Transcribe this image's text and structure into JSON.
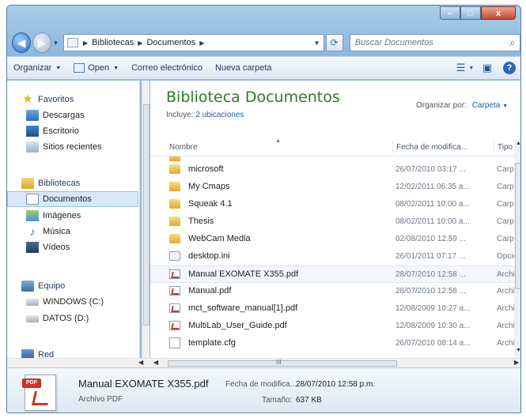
{
  "colors": {
    "library_title": "#2c7d27",
    "link": "#1a5fb4",
    "window_frame": "#8fb8de",
    "close_button": "#c74a2e"
  },
  "window": {
    "caption_buttons": [
      "minimize-icon",
      "maximize-icon",
      "close-icon"
    ],
    "close_glyph": "x"
  },
  "address": {
    "back_glyph": "◀",
    "forward_glyph": "▶",
    "crumbs": [
      "Bibliotecas",
      "Documentos"
    ],
    "search_placeholder": "Buscar Documentos"
  },
  "toolbar": {
    "organize": "Organizar",
    "open": "Open",
    "email": "Correo electrónico",
    "new_folder": "Nueva carpeta"
  },
  "nav": {
    "favorites": "Favoritos",
    "downloads": "Descargas",
    "desktop": "Escritorio",
    "recent": "Sitios recientes",
    "libraries": "Bibliotecas",
    "documents": "Documentos",
    "images": "Imágenes",
    "music": "Música",
    "videos": "Vídeos",
    "computer": "Equipo",
    "drive_c": "WINDOWS (C:)",
    "drive_d": "DATOS (D:)",
    "network": "Red"
  },
  "library": {
    "title": "Biblioteca Documentos",
    "includes_label": "Incluye:",
    "includes_link": "2 ubicaciones",
    "arrange_label": "Organizar por:",
    "arrange_value": "Carpeta"
  },
  "columns": {
    "name": "Nombre",
    "date": "Fecha de modifica...",
    "type": "Tipo"
  },
  "files": [
    {
      "name": "microsoft",
      "date": "26/07/2010 03:17 ...",
      "type": "Carpe",
      "icon": "folder-icon"
    },
    {
      "name": "My Cmaps",
      "date": "12/02/2011 06:35 a...",
      "type": "Carpe",
      "icon": "folder-icon"
    },
    {
      "name": "Squeak 4.1",
      "date": "08/02/2011 10:00 a...",
      "type": "Carpe",
      "icon": "folder-icon"
    },
    {
      "name": "Thesis",
      "date": "08/02/2011 10:00 a...",
      "type": "Carpe",
      "icon": "folder-icon"
    },
    {
      "name": "WebCam Media",
      "date": "02/08/2010 12:59 ...",
      "type": "Carpe",
      "icon": "folder-icon"
    },
    {
      "name": "desktop.ini",
      "date": "26/01/2011 07:17 ...",
      "type": "Opcic",
      "icon": "settings-file-icon"
    },
    {
      "name": "Manual EXOMATE X355.pdf",
      "date": "28/07/2010 12:58 ...",
      "type": "Archi",
      "icon": "pdf-icon"
    },
    {
      "name": "Manual.pdf",
      "date": "28/07/2010 12:58 ...",
      "type": "Archi",
      "icon": "pdf-icon"
    },
    {
      "name": "mct_software_manual[1].pdf",
      "date": "12/08/2009 10:27 a...",
      "type": "Archi",
      "icon": "pdf-icon"
    },
    {
      "name": "MultiLab_User_Guide.pdf",
      "date": "12/08/2009 10:30 a...",
      "type": "Archi",
      "icon": "pdf-icon"
    },
    {
      "name": "template.cfg",
      "date": "26/07/2010 08:14 a...",
      "type": "Archi",
      "icon": "file-icon"
    }
  ],
  "details": {
    "name": "Manual EXOMATE X355.pdf",
    "type": "Archivo PDF",
    "date_label": "Fecha de modifica...",
    "date_value": "28/07/2010 12:58 p.m.",
    "size_label": "Tamaño:",
    "size_value": "637 KB",
    "icon_badge": "PDF"
  },
  "scroll": {
    "hgrip": "III"
  }
}
